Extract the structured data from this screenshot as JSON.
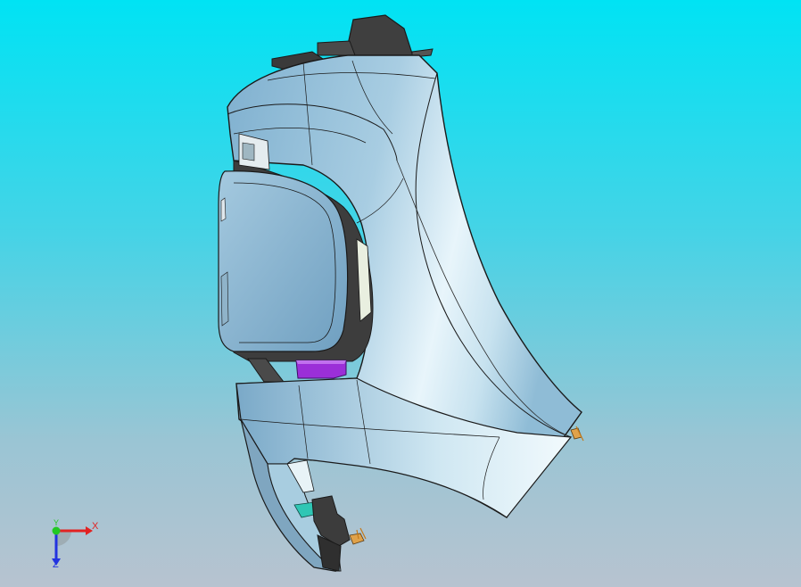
{
  "viewport": {
    "background_top": "#00e3f4",
    "background_bottom": "#b7c3d0"
  },
  "model": {
    "body_color": "#9cc4dd",
    "highlight_color": "#eaf6fc",
    "edge_color": "#1a1a1a",
    "dark_part_color": "#3c3c3c",
    "bracket_color": "#9b2fd8",
    "clip_color": "#e0a24a",
    "teal_part_color": "#2fc6b4"
  },
  "triad": {
    "x_label": "X",
    "y_label": "Y",
    "z_label": "Z",
    "x_color": "#e22222",
    "y_color": "#22c822",
    "z_color": "#2233e0"
  }
}
